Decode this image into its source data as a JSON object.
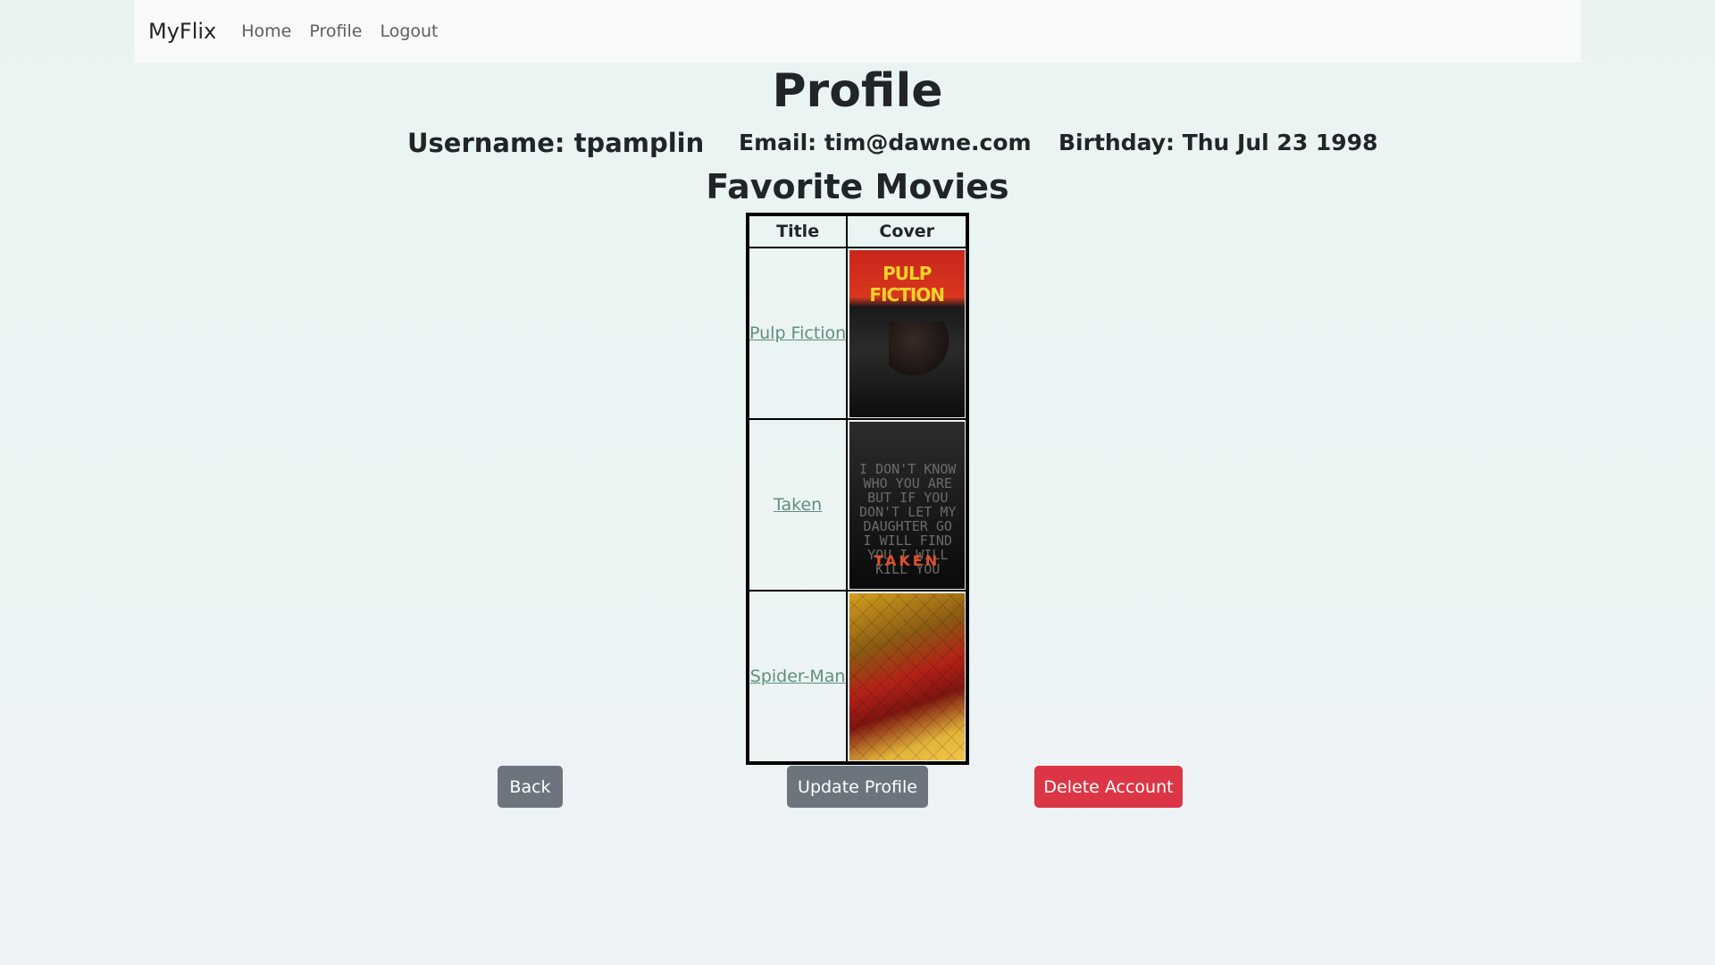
{
  "nav": {
    "brand": "MyFlix",
    "links": [
      "Home",
      "Profile",
      "Logout"
    ]
  },
  "page": {
    "title": "Profile"
  },
  "profile": {
    "username": "Username: tpamplin",
    "email": "Email: tim@dawne.com",
    "birthday": "Birthday: Thu Jul 23 1998"
  },
  "favorites": {
    "heading": "Favorite Movies",
    "columns": [
      "Title",
      "Cover"
    ],
    "movies": [
      {
        "title": "Pulp Fiction",
        "cover_text": "PULP FICTION"
      },
      {
        "title": "Taken",
        "cover_text": "TAKEN",
        "cover_lines": "I DON'T KNOW WHO YOU ARE BUT IF YOU DON'T LET MY DAUGHTER GO I WILL FIND YOU I WILL KILL YOU"
      },
      {
        "title": "Spider-Man"
      }
    ]
  },
  "buttons": {
    "back": "Back",
    "update": "Update Profile",
    "delete": "Delete Account"
  },
  "colors": {
    "secondary": "#6c757d",
    "danger": "#dc3545",
    "link": "#5f8f7d"
  }
}
